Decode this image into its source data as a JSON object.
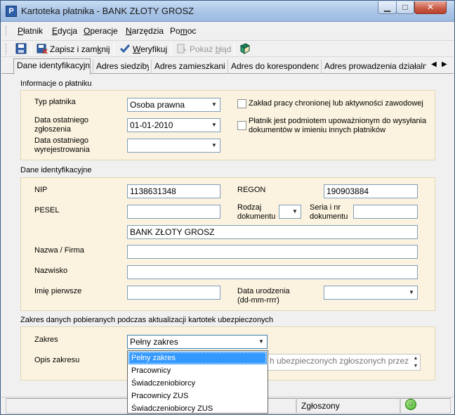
{
  "window": {
    "title": "Kartoteka płatnika  - BANK ZŁOTY GROSZ",
    "buttons": {
      "minimize": "▁",
      "maximize": "□",
      "close": "✕"
    }
  },
  "menu": {
    "items": [
      {
        "pre": "",
        "key": "P",
        "post": "łatnik"
      },
      {
        "pre": "",
        "key": "E",
        "post": "dycja"
      },
      {
        "pre": "",
        "key": "O",
        "post": "peracje"
      },
      {
        "pre": "",
        "key": "N",
        "post": "arzędzia"
      },
      {
        "pre": "Po",
        "key": "m",
        "post": "oc"
      }
    ]
  },
  "toolbar": {
    "save_close": {
      "pre": "Zapisz i zam",
      "key": "k",
      "post": "nij"
    },
    "verify": {
      "pre": "",
      "key": "W",
      "post": "eryfikuj"
    },
    "show_error": {
      "pre": "Pokaż ",
      "key": "b",
      "post": "łąd"
    },
    "icons": [
      "save-icon",
      "save-close-icon",
      "checkmark-icon",
      "show-error-icon",
      "book-icon"
    ],
    "colors": {
      "verify_check": "#2e5fa8",
      "book": "#1b7f5a"
    }
  },
  "tabs": [
    {
      "label": "Dane identyfikacyjne",
      "active": true
    },
    {
      "label": "Adres siedziby",
      "active": false
    },
    {
      "label": "Adres zamieszkania",
      "active": false
    },
    {
      "label": "Adres do korespondencji",
      "active": false
    },
    {
      "label": "Adres prowadzenia działalnoś",
      "active": false
    }
  ],
  "tab_arrows": {
    "left": "◀",
    "right": "▶"
  },
  "info": {
    "section_title": "Informacje o płatniku",
    "typ_label": "Typ płatnika",
    "typ_value": "Osoba prawna",
    "data_zgl_label_1": "Data ostatniego",
    "data_zgl_label_2": "zgłoszenia",
    "data_zgl_value": "01-01-2010",
    "data_wyrej_label_1": "Data ostatniego",
    "data_wyrej_label_2": "wyrejestrowania",
    "data_wyrej_value": "",
    "zaklad_label": "Zakład pracy chronionej lub aktywności zawodowej",
    "platnik_label_1": "Płatnik jest podmiotem upoważnionym do wysyłania",
    "platnik_label_2": "dokumentów w imieniu innych płatników",
    "zaklad_checked": false,
    "platnik_checked": false
  },
  "ident": {
    "section_title": "Dane identyfikacyjne",
    "nip_label": "NIP",
    "nip_value": "1138631348",
    "regon_label": "REGON",
    "regon_value": "190903884",
    "pesel_label": "PESEL",
    "pesel_value": "",
    "rodzaj_label_1": "Rodzaj",
    "rodzaj_label_2": "dokumentu",
    "seria_label_1": "Seria i nr",
    "seria_label_2": "dokumentu",
    "short_name_value": "BANK ZŁOTY GROSZ",
    "nazwa_label": "Nazwa / Firma",
    "nazwa_value": "",
    "nazwisko_label": "Nazwisko",
    "nazwisko_value": "",
    "imie_label": "Imię pierwsze",
    "imie_value": "",
    "data_ur_label_1": "Data urodzenia",
    "data_ur_label_2": "(dd-mm-rrrr)",
    "data_ur_value": ""
  },
  "zakres": {
    "section_title": "Zakres danych pobieranych podczas aktualizacji kartotek ubezpieczonych",
    "zakres_label": "Zakres",
    "zakres_value": "Pełny zakres",
    "opis_label": "Opis zakresu",
    "opis_value": "h ubezpieczonych zgłoszonych przez",
    "options": [
      "Pełny zakres",
      "Pracownicy",
      "Świadczeniobiorcy",
      "Pracownicy ZUS",
      "Świadczeniobiorcy ZUS"
    ],
    "selected_index": 0
  },
  "status": {
    "state": "Zgłoszony",
    "smiley": "☺"
  }
}
